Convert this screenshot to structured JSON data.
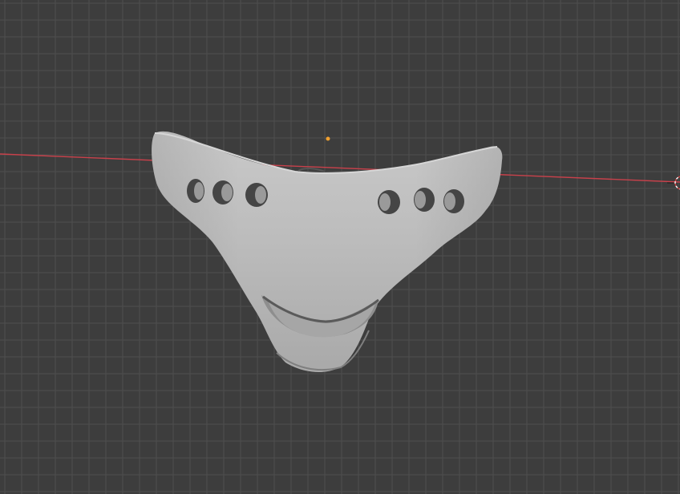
{
  "viewport": {
    "background_color": "#3d3d3d",
    "grid_color": "#4f4f4f",
    "x_axis_color": "#c8414b"
  },
  "scene": {
    "mesh": {
      "name": "mouth-mask-mesh",
      "color": "#bdbdbd",
      "hole_count_left": 3,
      "hole_count_right": 3
    },
    "origin_point": {
      "color": "#f0a030"
    },
    "cursor_3d": {
      "icon": "3d-cursor-icon"
    }
  }
}
